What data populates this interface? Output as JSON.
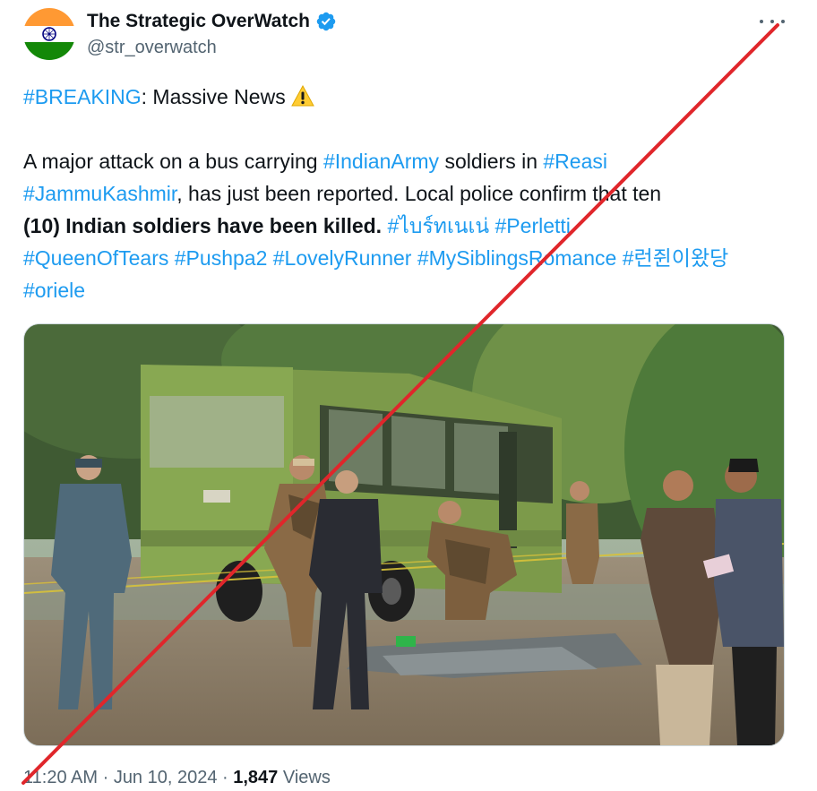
{
  "author": {
    "display_name": "The Strategic OverWatch",
    "handle": "@str_overwatch",
    "verified_icon": "verified-badge-icon",
    "avatar_icon": "indian-flag-avatar"
  },
  "more_icon": "more-dots-icon",
  "tweet": {
    "line1_tag": "#BREAKING",
    "line1_text": ": Massive News",
    "warning_icon": "warning-icon",
    "p2_text1": "A major attack on a bus carrying ",
    "p2_tag1": "#IndianArmy",
    "p2_text2": " soldiers in ",
    "p2_tag2": "#Reasi",
    "p2_tag3": "#JammuKashmir",
    "p2_text3": ", has just been reported. Local police confirm that ten",
    "p2_bold": "(10) Indian soldiers have been killed.",
    "p2_space": " ",
    "hashtags": [
      "#ไบร์ทเนเน่",
      "#Perletti",
      "#QueenOfTears",
      "#Pushpa2",
      "#LovelyRunner",
      "#MySiblingsRomance",
      "#런쥔이왔당",
      "#oriele"
    ]
  },
  "media": {
    "subject": "photo of damaged green bus at attack site with soldiers and officials"
  },
  "footer": {
    "time": "11:20 AM",
    "sep1": " · ",
    "date": "Jun 10, 2024",
    "sep2": " · ",
    "views_count": "1,847",
    "views_label": " Views"
  },
  "overlay": {
    "strike_color": "#e0262b"
  },
  "colors": {
    "link": "#1d9bf0",
    "text": "#0f1419",
    "secondary": "#536471",
    "verified": "#1d9bf0"
  }
}
